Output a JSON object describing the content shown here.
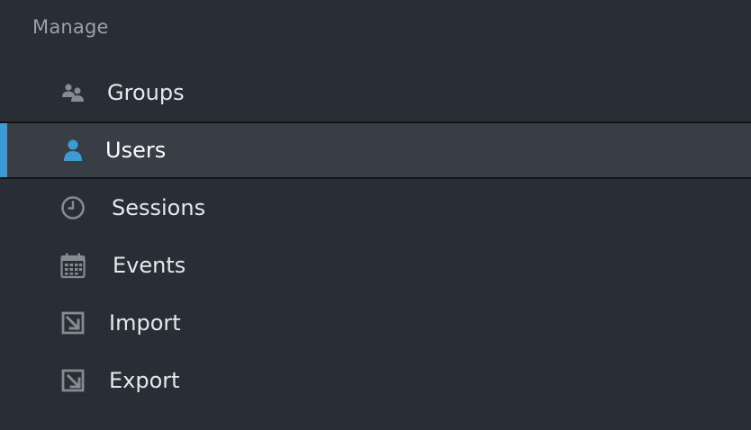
{
  "sidebar": {
    "section_heading": "Manage",
    "items": [
      {
        "label": "Groups",
        "icon": "groups-icon",
        "active": false
      },
      {
        "label": "Users",
        "icon": "user-icon",
        "active": true
      },
      {
        "label": "Sessions",
        "icon": "clock-icon",
        "active": false
      },
      {
        "label": "Events",
        "icon": "calendar-icon",
        "active": false
      },
      {
        "label": "Import",
        "icon": "import-icon",
        "active": false
      },
      {
        "label": "Export",
        "icon": "export-icon",
        "active": false
      }
    ]
  },
  "colors": {
    "background": "#292d35",
    "active_background": "#393d45",
    "accent": "#3a9bd5",
    "icon_muted": "#868a91",
    "text": "#e6e8eb",
    "heading": "#9ca0a7"
  }
}
